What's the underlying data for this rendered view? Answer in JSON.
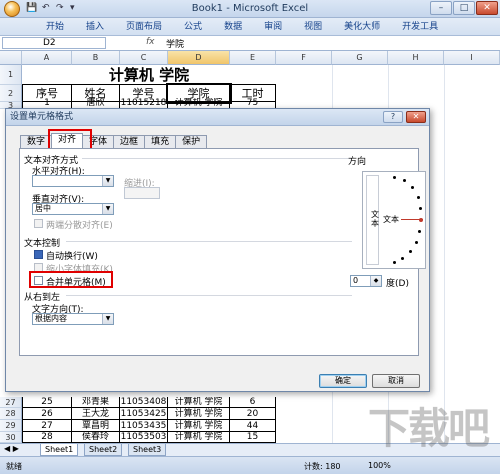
{
  "window": {
    "title": "Book1 - Microsoft Excel",
    "quick_access": "▾",
    "minimize": "–",
    "maximize": "□",
    "close": "✕"
  },
  "ribbon": {
    "tabs": [
      "开始",
      "插入",
      "页面布局",
      "公式",
      "数据",
      "审阅",
      "视图",
      "美化大师",
      "开发工具"
    ]
  },
  "formula_bar": {
    "cell_ref": "D2",
    "fx": "fx",
    "value": "学院"
  },
  "sheet": {
    "columns": [
      "A",
      "B",
      "C",
      "D",
      "E",
      "F",
      "G",
      "H",
      "I"
    ],
    "rows_top": [
      {
        "num": "1",
        "cells": [
          "计算机 学院"
        ]
      },
      {
        "num": "2",
        "cells": [
          "序号",
          "姓名",
          "学号",
          "学院",
          "工时"
        ]
      },
      {
        "num": "3",
        "cells": [
          "1",
          "唐欣",
          "11015218",
          "计算机 学院",
          "75"
        ]
      }
    ],
    "rows_bottom": [
      {
        "num": "27",
        "cells": [
          "25",
          "邓青果",
          "11053408",
          "计算机 学院",
          "6"
        ]
      },
      {
        "num": "28",
        "cells": [
          "26",
          "王大龙",
          "11053425",
          "计算机 学院",
          "20"
        ]
      },
      {
        "num": "29",
        "cells": [
          "27",
          "覃昌明",
          "11053435",
          "计算机 学院",
          "44"
        ]
      },
      {
        "num": "30",
        "cells": [
          "28",
          "侯春玲",
          "11053503",
          "计算机 学院",
          "15"
        ]
      }
    ]
  },
  "sheet_tabs": [
    "Sheet1",
    "Sheet2",
    "Sheet3"
  ],
  "status": {
    "mode": "就绪",
    "count": "计数: 180",
    "zoom": "100%"
  },
  "dialog": {
    "title": "设置单元格格式",
    "help": "?",
    "close": "✕",
    "tabs": [
      "数字",
      "对齐",
      "字体",
      "边框",
      "填充",
      "保护"
    ],
    "active_tab": "对齐",
    "text_alignment": {
      "section": "文本对齐方式",
      "horizontal_label": "水平对齐(H):",
      "horizontal_value": "",
      "indent_label": "缩进(I):",
      "indent_value": "",
      "vertical_label": "垂直对齐(V):",
      "vertical_value": "居中",
      "distributed": "两端分散对齐(E)"
    },
    "text_control": {
      "section": "文本控制",
      "wrap_text": "自动换行(W)",
      "wrap_checked": true,
      "shrink_to_fit": "缩小字体填充(K)",
      "merge_cells": "合并单元格(M)",
      "merge_checked": false
    },
    "rtl": {
      "section": "从右到左",
      "direction_label": "文字方向(T):",
      "direction_value": "根据内容"
    },
    "orientation": {
      "section": "方向",
      "vertical_text": "文本",
      "horizontal_text": "文本",
      "degrees_value": "0",
      "degrees_label": "度(D)"
    },
    "buttons": {
      "ok": "确定",
      "cancel": "取消"
    }
  },
  "colors": {
    "highlight": "#e00000",
    "title_blue": "#1e395b",
    "accent_blue": "#3a67b8"
  },
  "watermark": "下载吧"
}
